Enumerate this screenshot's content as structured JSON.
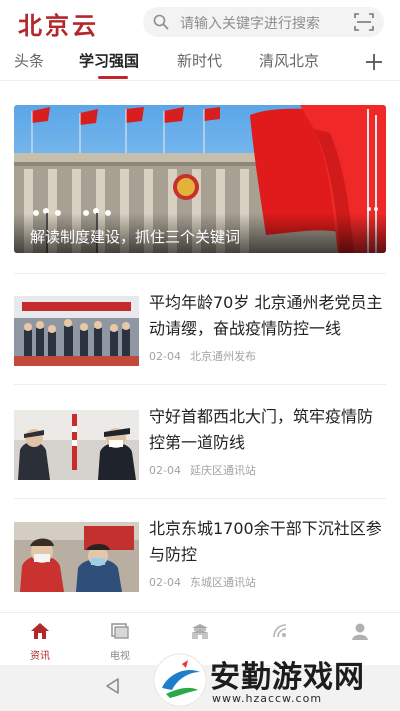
{
  "app": {
    "logo_text": "北京云",
    "brand_color": "#b3282d"
  },
  "search": {
    "placeholder": "请输入关键字进行搜索",
    "icon": "search-icon",
    "scan_icon": "scan-icon"
  },
  "tabs": [
    {
      "label": "头条",
      "active": false
    },
    {
      "label": "学习强国",
      "active": true
    },
    {
      "label": "新时代",
      "active": false
    },
    {
      "label": "清风北京",
      "active": false
    }
  ],
  "add_tab_icon": "plus-icon",
  "banner": {
    "caption": "解读制度建设，抓住三个关键词",
    "slide_count": 2
  },
  "news": [
    {
      "title": "平均年龄70岁 北京通州老党员主动请缨，奋战疫情防控一线",
      "date": "02-04",
      "source": "北京通州发布"
    },
    {
      "title": "守好首都西北大门，筑牢疫情防控第一道防线",
      "date": "02-04",
      "source": "延庆区通讯站"
    },
    {
      "title": "北京东城1700余干部下沉社区参与防控",
      "date": "02-04",
      "source": "东城区通讯站"
    }
  ],
  "bottom_nav": [
    {
      "label": "资讯",
      "icon": "home-icon",
      "active": true
    },
    {
      "label": "电视",
      "icon": "tv-icon",
      "active": false
    },
    {
      "label": "",
      "icon": "tiananmen-icon",
      "active": false
    },
    {
      "label": "",
      "icon": "broadcast-icon",
      "active": false
    },
    {
      "label": "",
      "icon": "user-icon",
      "active": false
    }
  ],
  "system_nav": {
    "back_icon": "back-icon"
  },
  "watermark": {
    "name": "安勤游戏网",
    "url": "www.hzaccw.com"
  }
}
